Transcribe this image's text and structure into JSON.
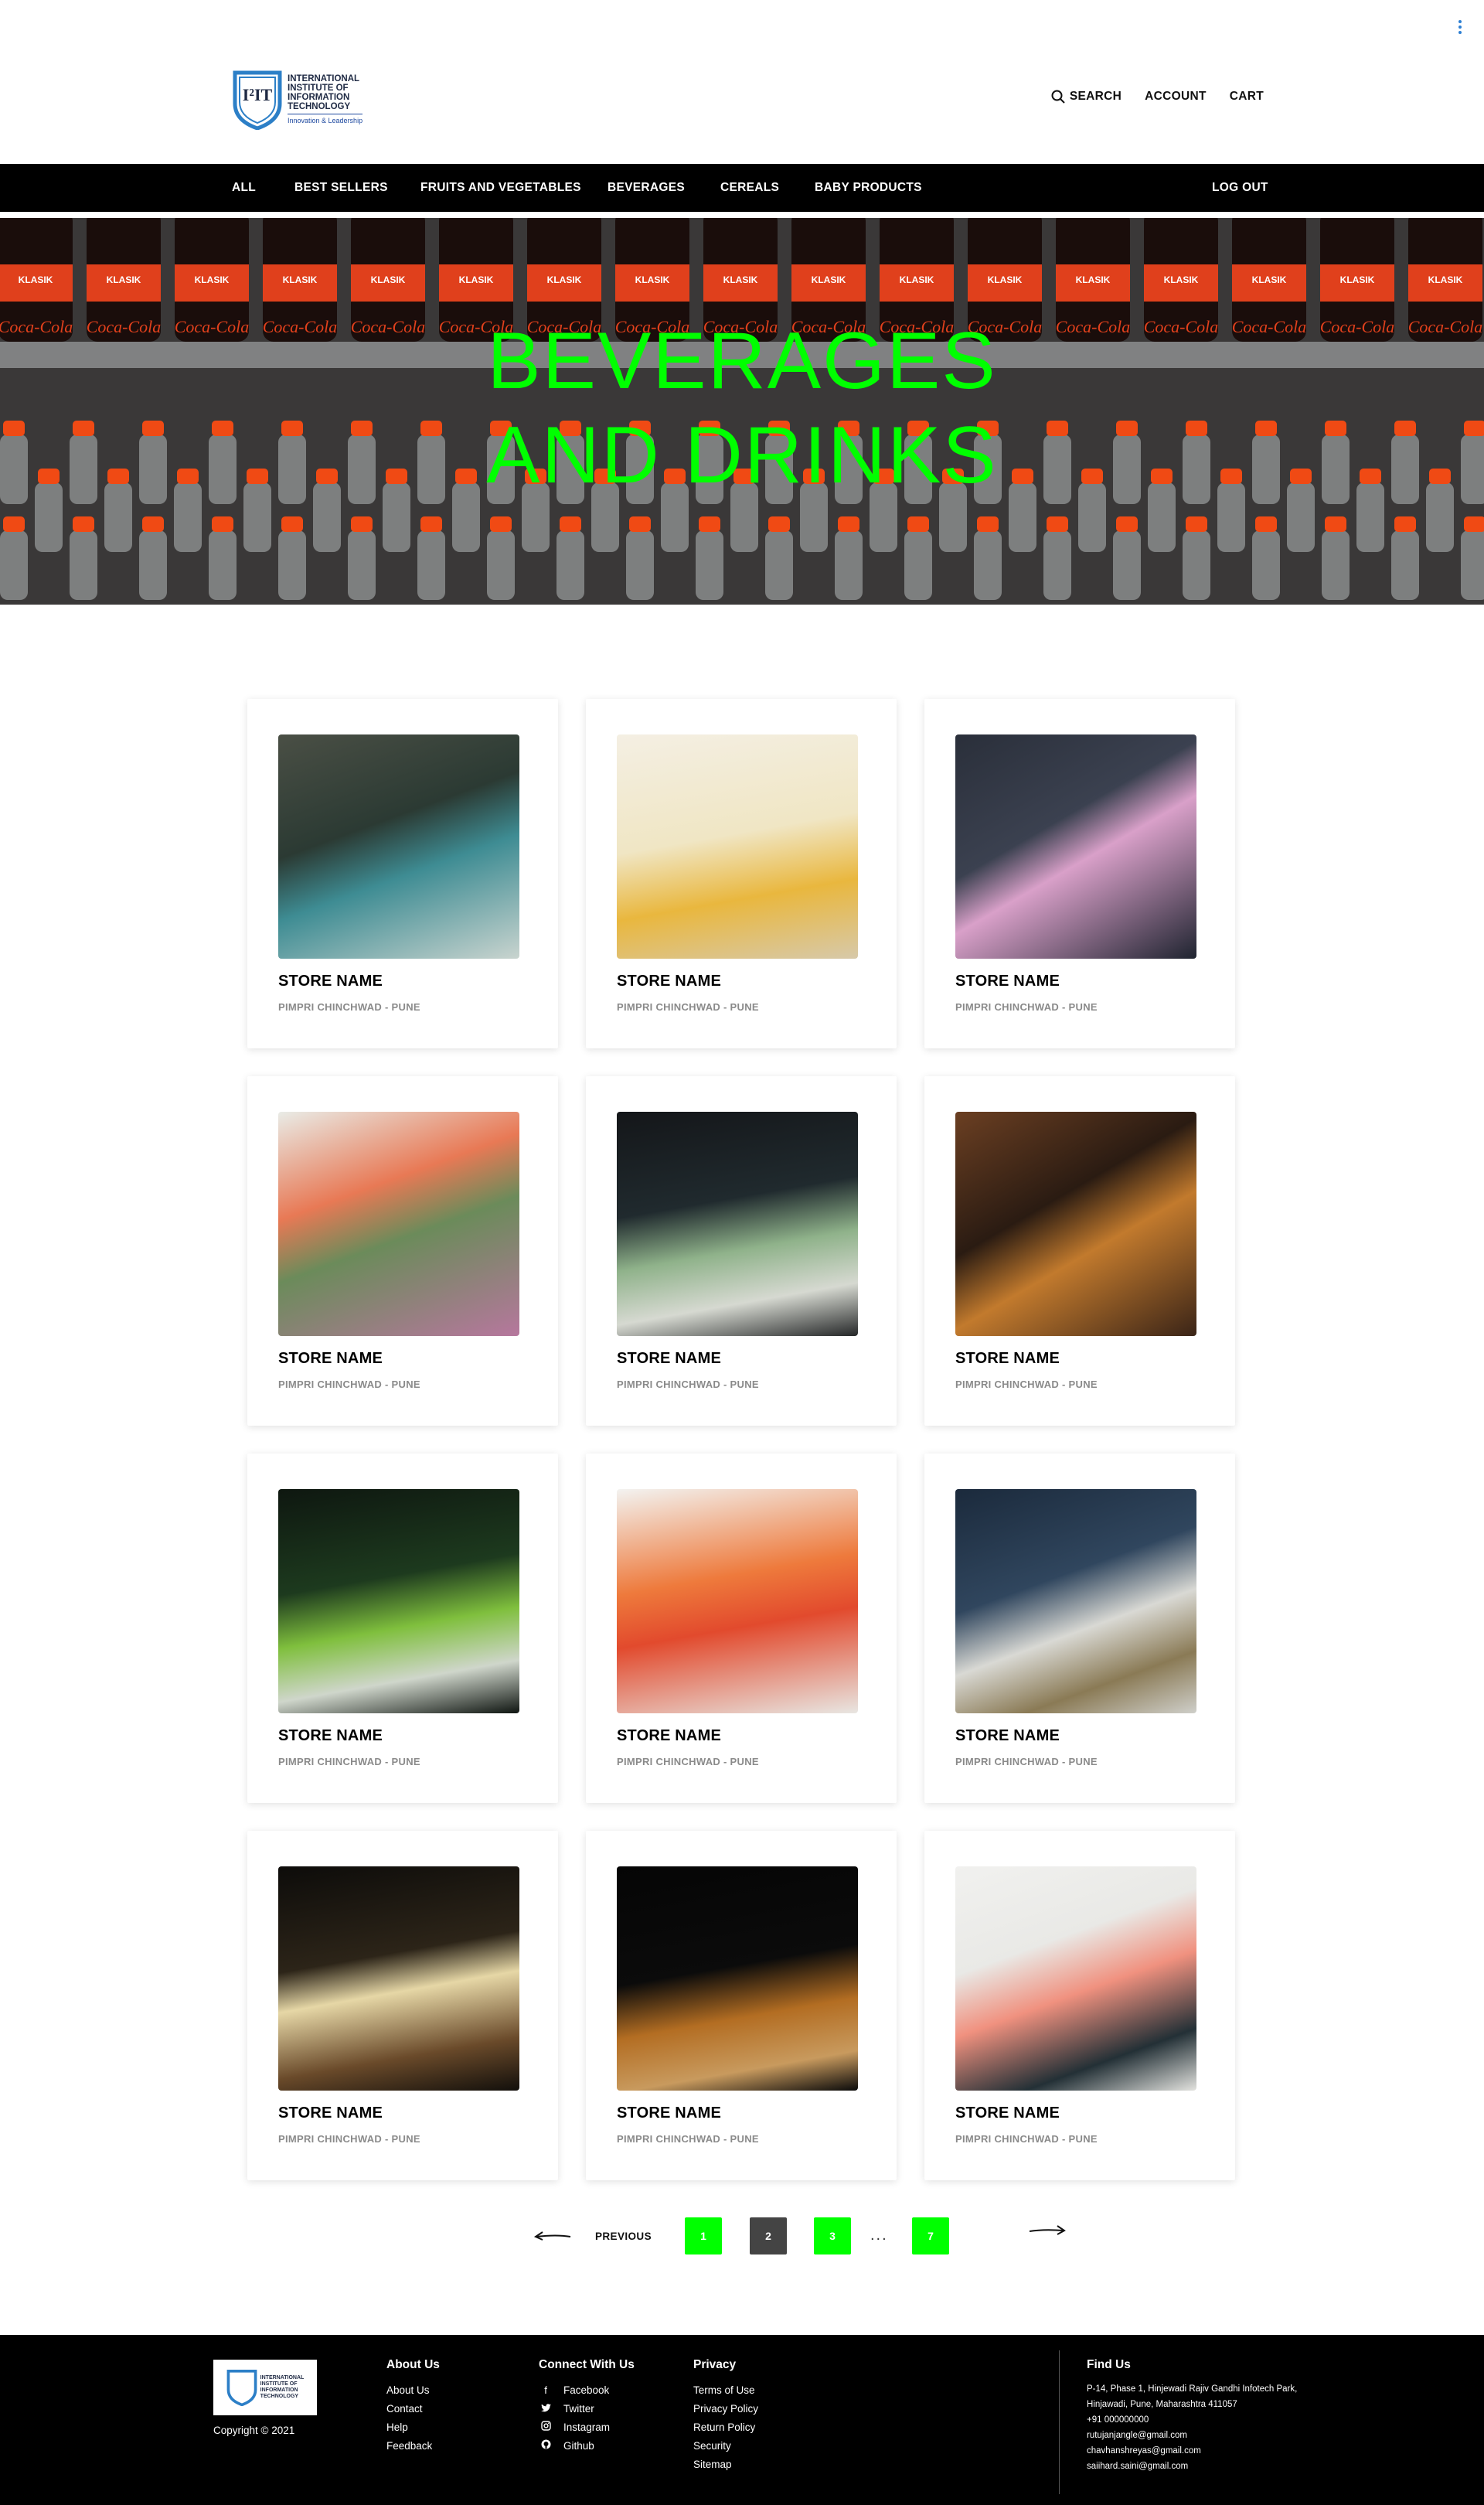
{
  "header": {
    "logo": {
      "mark": "I²IT",
      "line1": "INTERNATIONAL",
      "line2": "INSTITUTE OF",
      "line3": "INFORMATION",
      "line4": "TECHNOLOGY",
      "tagline": "Innovation & Leadership"
    },
    "search_label": "SEARCH",
    "account_label": "ACCOUNT",
    "cart_label": "CART"
  },
  "nav": {
    "items": [
      "ALL",
      "BEST SELLERS",
      "FRUITS AND VEGETABLES",
      "BEVERAGES",
      "CEREALS",
      "BABY PRODUCTS"
    ],
    "logout_label": "LOG OUT"
  },
  "hero": {
    "title": "BEVERAGES\nAND DRINKS",
    "label_text": "KLASIK",
    "brand_text": "Coca-Cola"
  },
  "cards": [
    {
      "name": "STORE NAME",
      "location": "PIMPRI CHINCHWAD - PUNE"
    },
    {
      "name": "STORE NAME",
      "location": "PIMPRI CHINCHWAD - PUNE"
    },
    {
      "name": "STORE NAME",
      "location": "PIMPRI CHINCHWAD - PUNE"
    },
    {
      "name": "STORE NAME",
      "location": "PIMPRI CHINCHWAD - PUNE"
    },
    {
      "name": "STORE NAME",
      "location": "PIMPRI CHINCHWAD - PUNE"
    },
    {
      "name": "STORE NAME",
      "location": "PIMPRI CHINCHWAD - PUNE"
    },
    {
      "name": "STORE NAME",
      "location": "PIMPRI CHINCHWAD - PUNE"
    },
    {
      "name": "STORE NAME",
      "location": "PIMPRI CHINCHWAD - PUNE"
    },
    {
      "name": "STORE NAME",
      "location": "PIMPRI CHINCHWAD - PUNE"
    },
    {
      "name": "STORE NAME",
      "location": "PIMPRI CHINCHWAD - PUNE"
    },
    {
      "name": "STORE NAME",
      "location": "PIMPRI CHINCHWAD - PUNE"
    },
    {
      "name": "STORE NAME",
      "location": "PIMPRI CHINCHWAD - PUNE"
    }
  ],
  "pagination": {
    "previous_label": "PREVIOUS",
    "pages": [
      "1",
      "2",
      "3",
      "7"
    ],
    "ellipsis": "...",
    "accent_color": "#00ff00",
    "dark_color": "#444444"
  },
  "footer": {
    "copyright": "Copyright © 2021",
    "about": {
      "heading": "About Us",
      "links": [
        "About Us",
        "Contact",
        "Help",
        "Feedback"
      ]
    },
    "connect": {
      "heading": "Connect With Us",
      "links": [
        "Facebook",
        "Twitter",
        "Instagram",
        "Github"
      ],
      "icons": [
        "facebook-icon",
        "twitter-icon",
        "instagram-icon",
        "github-icon"
      ]
    },
    "privacy": {
      "heading": "Privacy",
      "links": [
        "Terms of Use",
        "Privacy Policy",
        "Return Policy",
        "Security",
        "Sitemap"
      ]
    },
    "find": {
      "heading": "Find Us",
      "lines": [
        "P-14, Phase 1, Hinjewadi Rajiv Gandhi Infotech Park,",
        "Hinjawadi, Pune, Maharashtra 411057",
        "+91 000000000",
        "rutujanjangle@gmail.com",
        "chavhanshreyas@gmail.com",
        "saiihard.saini@gmail.com"
      ]
    }
  },
  "colors": {
    "accent": "#00ff00",
    "nav_bg": "#000000",
    "footer_bg": "#000000"
  }
}
